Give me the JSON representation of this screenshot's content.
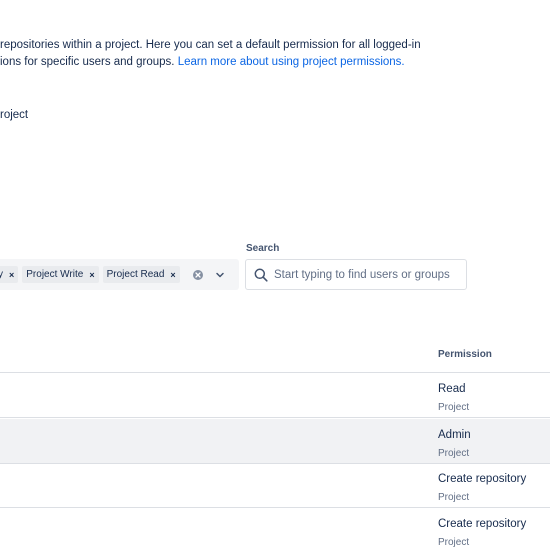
{
  "intro": {
    "line1": "repositories within a project. Here you can set a default permission for all logged-in",
    "line2_prefix": "ions for specific users and groups. ",
    "link": "Learn more about using project permissions."
  },
  "default_permission_label": "roject",
  "filter": {
    "tags": [
      {
        "label": "y"
      },
      {
        "label": "Project Write"
      },
      {
        "label": "Project Read"
      }
    ],
    "remove_glyph": "×"
  },
  "search": {
    "label": "Search",
    "placeholder": "Start typing to find users or groups"
  },
  "table": {
    "permission_header": "Permission",
    "rows": [
      {
        "permission": "Read",
        "scope": "Project",
        "highlighted": false
      },
      {
        "permission": "Admin",
        "scope": "Project",
        "highlighted": true
      },
      {
        "permission": "Create repository",
        "scope": "Project",
        "highlighted": false
      },
      {
        "permission": "Create repository",
        "scope": "Project",
        "highlighted": false
      }
    ]
  },
  "colors": {
    "link": "#0c66e4",
    "text": "#172b4d",
    "subtle": "#626f86",
    "row_highlight": "#f1f2f4"
  }
}
